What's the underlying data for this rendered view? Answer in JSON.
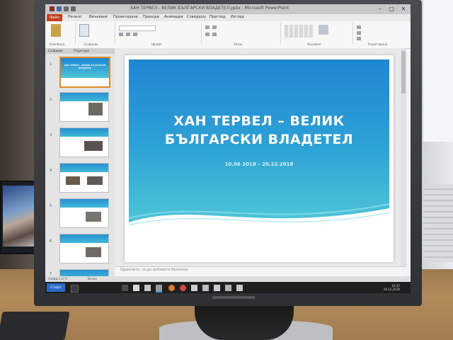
{
  "window": {
    "title": "ХАН ТЕРВЕЛ - ВЕЛИК БЪЛГАРСКИ ВЛАДЕТЕЛ.pptx - Microsoft PowerPoint",
    "minimize": "–",
    "maximize": "□",
    "close": "✕"
  },
  "ribbon": {
    "file_tab": "Файл",
    "tabs": [
      "Начало",
      "Вмъкване",
      "Проектиране",
      "Преходи",
      "Анимации",
      "Слайдшоу",
      "Преглед",
      "Изглед"
    ],
    "groups": [
      "Клипборд",
      "Слайдове",
      "Шрифт",
      "Абзац",
      "Рисуване",
      "Редактиране"
    ]
  },
  "slides_pane": {
    "tabs": [
      "Слайдове",
      "Структура"
    ],
    "thumbnails": [
      {
        "num": "1",
        "title": "ХАН ТЕРВЕЛ – ВЕЛИК БЪЛГАРСКИ ВЛАДЕТЕЛ"
      },
      {
        "num": "2",
        "title": ""
      },
      {
        "num": "3",
        "title": ""
      },
      {
        "num": "4",
        "title": ""
      },
      {
        "num": "5",
        "title": ""
      },
      {
        "num": "6",
        "title": ""
      },
      {
        "num": "7",
        "title": ""
      }
    ]
  },
  "slide": {
    "title_line1": "ХАН ТЕРВЕЛ – ВЕЛИК",
    "title_line2": "БЪЛГАРСКИ ВЛАДЕТЕЛ",
    "subtitle": "10.06 2018 – 20.12.2018"
  },
  "notes": {
    "placeholder": "Щракнете, за да добавите бележки"
  },
  "status": {
    "slide_info": "Слайд 1 от 9",
    "theme": "Волна"
  },
  "taskbar": {
    "start": "Старт",
    "clock_time": "10:25",
    "clock_date": "20.12.2018"
  },
  "colors": {
    "accent": "#c43e1c",
    "slide_blue": "#1f86d3",
    "slide_teal": "#4ec5d8"
  }
}
